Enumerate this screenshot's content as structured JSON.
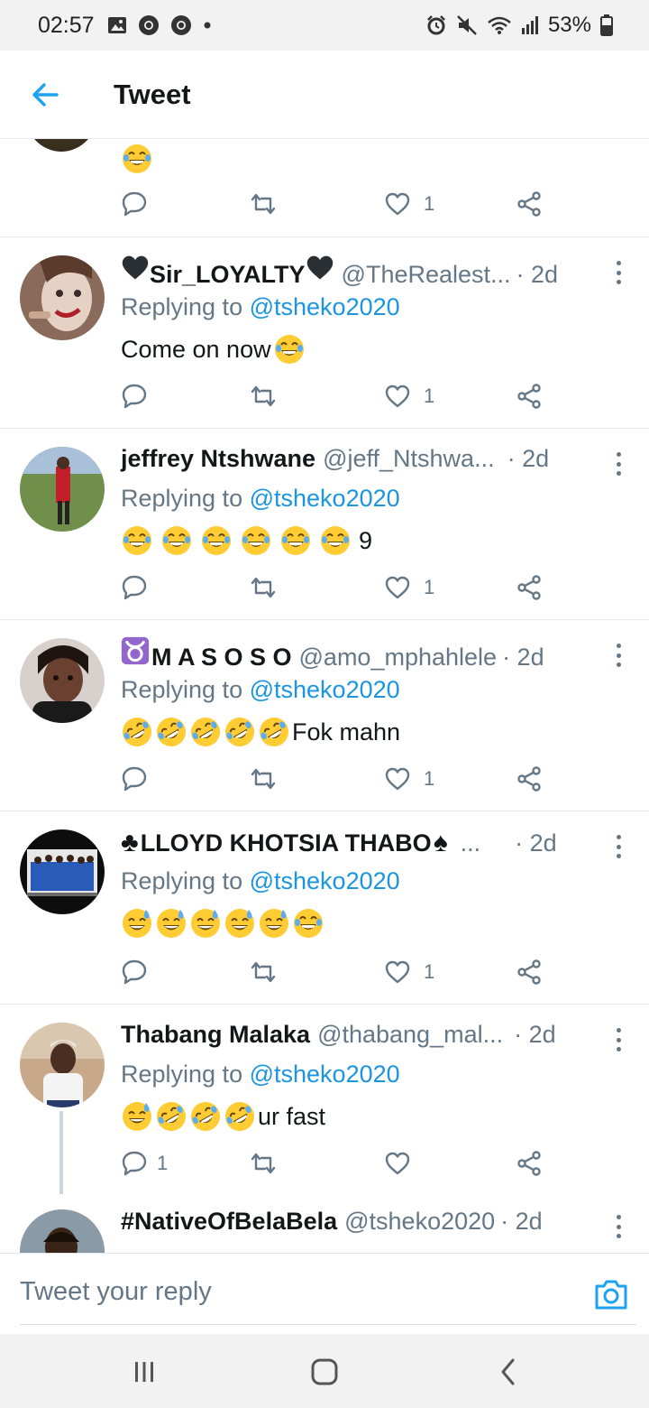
{
  "status_bar": {
    "time": "02:57",
    "battery": "53%",
    "left_icons": [
      "gallery-icon",
      "chrome-icon",
      "chrome-icon",
      "dot-icon"
    ],
    "right_icons": [
      "alarm-icon",
      "mute-icon",
      "wifi-icon",
      "signal-icon",
      "battery-icon"
    ]
  },
  "header": {
    "title": "Tweet",
    "back_icon": "arrow-left-icon",
    "accent": "#1da1f2"
  },
  "partial_tweet": {
    "text_emojis": [
      "joy"
    ],
    "likes": "1"
  },
  "replies": [
    {
      "prefix_emoji": "black-heart",
      "name": "Sir_LOYALTY",
      "suffix_emoji": "black-heart",
      "handle": "@TheRealest...",
      "time": "· 2d",
      "replying_label": "Replying to",
      "replying_to": "@tsheko2020",
      "text": "Come on now",
      "text_emojis_after": [
        "joy"
      ],
      "likes": "1",
      "replies": ""
    },
    {
      "name": "jeffrey Ntshwane",
      "handle": "@jeff_Ntshwa...",
      "time": "· 2d",
      "replying_label": "Replying to",
      "replying_to": "@tsheko2020",
      "text_emojis_before": [
        "joy",
        "joy",
        "joy",
        "joy",
        "joy",
        "joy"
      ],
      "text": "9",
      "likes": "1",
      "replies": ""
    },
    {
      "prefix_emoji": "taurus",
      "name": "M A S O S O",
      "handle": "@amo_mphahlele",
      "time": "· 2d",
      "replying_label": "Replying to",
      "replying_to": "@tsheko2020",
      "text_emojis_before": [
        "rofl",
        "rofl",
        "rofl",
        "rofl",
        "rofl"
      ],
      "text": "Fok mahn",
      "likes": "1",
      "replies": ""
    },
    {
      "prefix_emoji": "club-suit",
      "name": "LLOYD KHOTSIA THABO",
      "suffix_emoji": "spade-suit",
      "handle": "...",
      "time": "· 2d",
      "replying_label": "Replying to",
      "replying_to": "@tsheko2020",
      "text_emojis_before": [
        "sweat-smile",
        "sweat-smile",
        "sweat-smile",
        "sweat-smile",
        "sweat-smile",
        "joy"
      ],
      "text": "",
      "likes": "1",
      "replies": ""
    },
    {
      "name": "Thabang Malaka",
      "handle": "@thabang_mal...",
      "time": "· 2d",
      "replying_label": "Replying to",
      "replying_to": "@tsheko2020",
      "text_emojis_before": [
        "sweat-smile",
        "rofl",
        "rofl",
        "rofl"
      ],
      "text": "ur fast",
      "likes": "",
      "replies": "1"
    },
    {
      "name": "#NativeOfBelaBela",
      "handle": "@tsheko2020",
      "time": "· 2d"
    }
  ],
  "compose": {
    "placeholder": "Tweet your reply",
    "camera_icon": "camera-icon"
  },
  "nav_bar": {
    "buttons": [
      "recent-apps-icon",
      "home-icon",
      "back-icon"
    ]
  },
  "colors": {
    "link": "#1b95e0",
    "muted": "#657786",
    "divider": "#e1e8ed"
  }
}
